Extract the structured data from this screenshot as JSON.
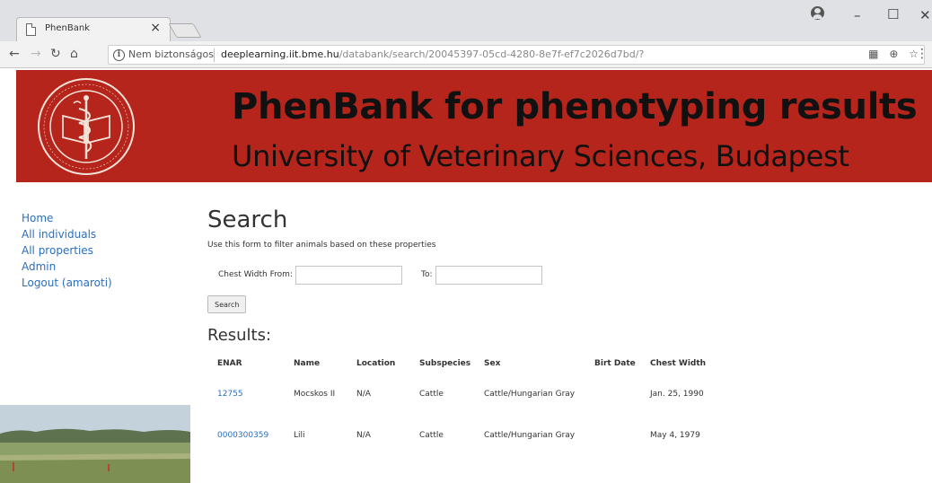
{
  "browser": {
    "tab_title": "PhenBank",
    "tab_close": "×",
    "security_label": "Nem biztonságos",
    "url_host": "deeplearning.iit.bme.hu",
    "url_path": "/databank/search/20045397-05cd-4280-8e7f-ef7c2026d7bd/?"
  },
  "banner": {
    "title": "PhenBank for phenotyping results",
    "subtitle": "University of Veterinary Sciences, Budapest"
  },
  "sidebar": {
    "items": [
      {
        "label": "Home"
      },
      {
        "label": "All individuals"
      },
      {
        "label": "All properties"
      },
      {
        "label": "Admin"
      },
      {
        "label": "Logout (amaroti)"
      }
    ]
  },
  "main": {
    "title": "Search",
    "description": "Use this form to filter animals based on these properties",
    "form": {
      "from_label": "Chest Width From:",
      "from_value": "",
      "to_label": "To:",
      "to_value": "",
      "submit_label": "Search"
    },
    "results": {
      "title": "Results:",
      "columns": [
        "ENAR",
        "Name",
        "Location",
        "Subspecies",
        "Sex",
        "Birt Date",
        "Chest Width"
      ],
      "rows": [
        [
          "12755",
          "Mocskos II",
          "N/A",
          "Cattle",
          "Cattle/Hungarian Gray",
          "",
          "Jan. 25, 1990"
        ],
        [
          "0000300359",
          "Lili",
          "N/A",
          "Cattle",
          "Cattle/Hungarian Gray",
          "",
          "May 4, 1979"
        ]
      ]
    }
  }
}
